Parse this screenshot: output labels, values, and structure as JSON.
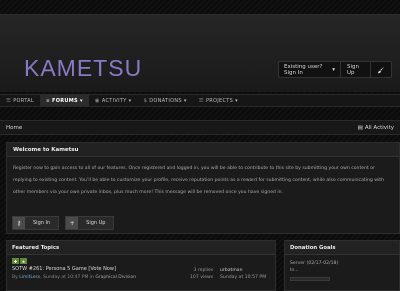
{
  "header": {
    "logo": "KAMETSU",
    "userbar": {
      "signin_label": "Existing user? Sign In",
      "signup_label": "Sign Up"
    }
  },
  "nav": {
    "items": [
      {
        "label": "PORTAL",
        "icon": "list-icon"
      },
      {
        "label": "FORUMS",
        "icon": "comments-icon",
        "active": true
      },
      {
        "label": "ACTIVITY",
        "icon": "activity-icon"
      },
      {
        "label": "DONATIONS",
        "icon": "dollar-icon"
      },
      {
        "label": "PROJECTS",
        "icon": "list-icon"
      }
    ]
  },
  "breadcrumb": {
    "home": "Home",
    "right": "All Activity"
  },
  "welcome": {
    "title": "Welcome to Kametsu",
    "text": "Register now to gain access to all of our features. Once registered and logged in, you will be able to contribute to this site by submitting your own content or replying to existing content. You'll be able to customize your profile, receive reputation points as a reward for submitting content, while also communicating with other members via your own private inbox, plus much more! This message will be removed once you have signed in.",
    "signin_label": "Sign In",
    "signup_label": "Sign Up"
  },
  "featured": {
    "title": "Featured Topics",
    "topic": {
      "title": "SOTW #261: Persona 5 Game [Vote Now]",
      "by": "By",
      "author": "LimitLess",
      "date": "Sunday at 10:47 PM in",
      "forum": "Graphical Division",
      "replies": "3 replies",
      "views": "107 views",
      "last_user": "urbatman",
      "last_time": "Sunday at 10:57 PM"
    }
  },
  "donation": {
    "title": "Donation Goals",
    "server_label": "Server (02/17-02/18)",
    "amount": "In...",
    "progress": 0.0
  },
  "colors": {
    "accent": "#8a7ac6",
    "tag_green": "#5f8a3a",
    "link_blue": "#7fa8d8"
  }
}
